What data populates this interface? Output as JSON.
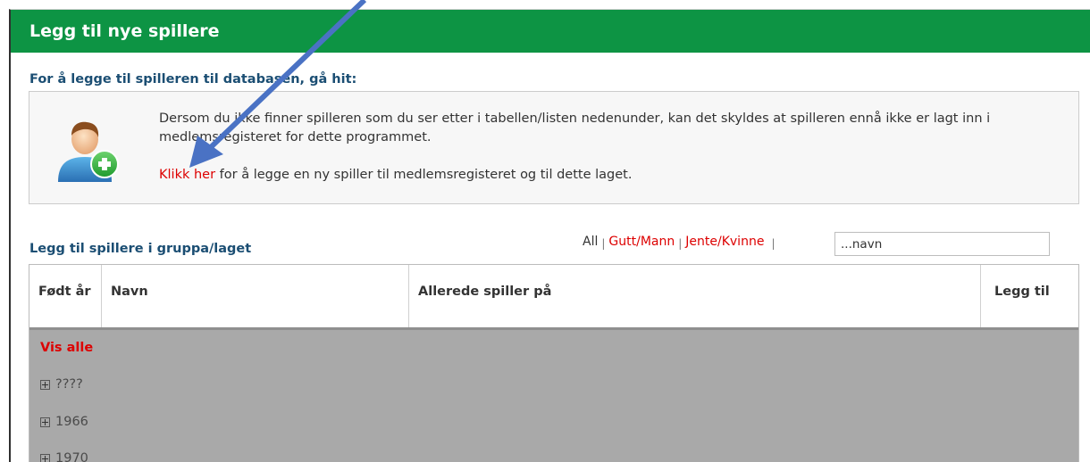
{
  "header": {
    "title": "Legg til nye spillere"
  },
  "database_section": {
    "title": "For å legge til spilleren til databasen, gå hit:",
    "info_text": "Dersom du ikke finner spilleren som du ser etter i tabellen/listen nedenunder, kan det skyldes at spilleren ennå ikke er lagt inn i medlemsregisteret for dette programmet.",
    "link_label": "Klikk her",
    "link_suffix": " for å legge en ny spiller til medlemsregisteret og til dette laget.",
    "icon": "add-user-icon"
  },
  "players_section": {
    "title": "Legg til spillere i gruppa/laget",
    "filters": {
      "all": "All",
      "male": "Gutt/Mann",
      "female": "Jente/Kvinne",
      "separator": "|"
    },
    "search": {
      "placeholder": "...navn",
      "value": ""
    }
  },
  "table": {
    "columns": {
      "born": "Født år",
      "name": "Navn",
      "already_playing": "Allerede spiller på",
      "add": "Legg til"
    },
    "show_all": "Vis alle",
    "groups": [
      "????",
      "1966",
      "1970"
    ]
  },
  "colors": {
    "header_bg": "#0d9444",
    "link": "#dd0000",
    "section_title": "#1b4e73",
    "arrow": "#4a72c4"
  }
}
